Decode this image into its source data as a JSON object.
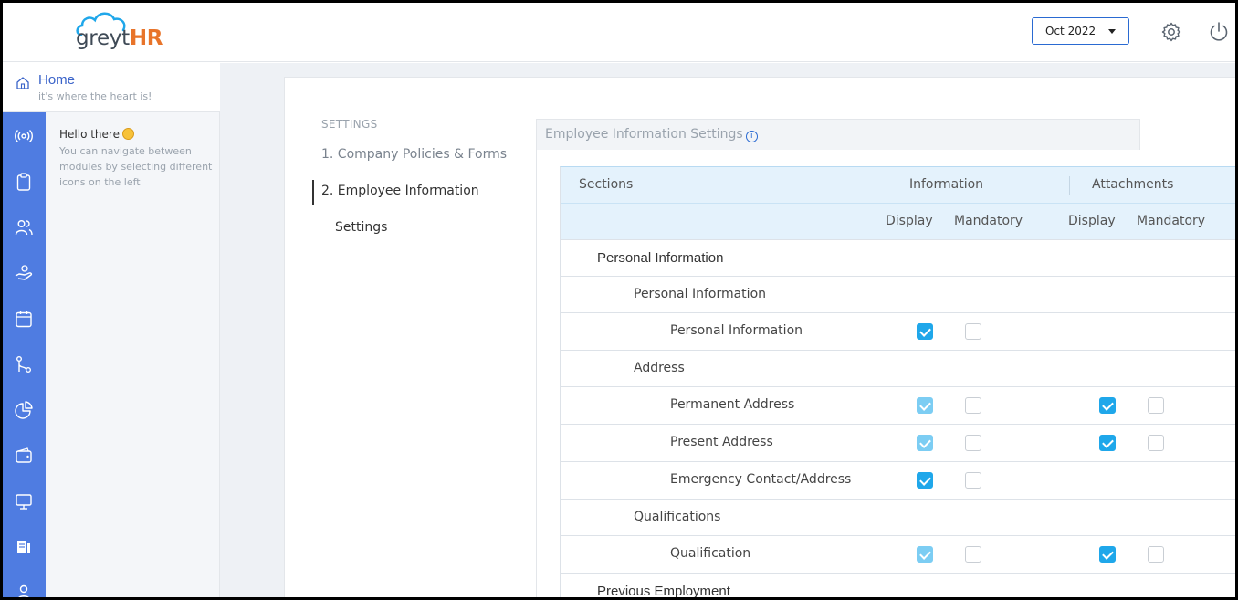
{
  "brand": {
    "logo_text_1": "greyt",
    "logo_text_2": "HR"
  },
  "header": {
    "month_value": "Oct 2022"
  },
  "home": {
    "title": "Home",
    "subtitle": "it's where the heart is!"
  },
  "help": {
    "greeting": "Hello there",
    "message": "You can navigate between modules by selecting different icons on the left"
  },
  "rail_icons": [
    "broadcast-icon",
    "clipboard-icon",
    "users-icon",
    "hand-coins-icon",
    "calendar-icon",
    "workflow-icon",
    "pie-chart-icon",
    "wallet-icon",
    "monitor-icon",
    "document-icon",
    "person-icon"
  ],
  "settings_nav": {
    "heading": "SETTINGS",
    "items": [
      {
        "label": "1. Company Policies & Forms",
        "active": false
      },
      {
        "label": "2. Employee Information",
        "active": true
      },
      {
        "label": "Settings",
        "active": true
      }
    ]
  },
  "content": {
    "title": "Employee Information Settings",
    "columns": {
      "sections": "Sections",
      "information": "Information",
      "attachments": "Attachments",
      "display": "Display",
      "mandatory": "Mandatory"
    },
    "rows": [
      {
        "label": "Personal Information",
        "level": 0
      },
      {
        "label": "Personal Information",
        "level": 1
      },
      {
        "label": "Personal Information",
        "level": 2,
        "info_display": "checked",
        "info_mandatory": "unchecked"
      },
      {
        "label": "Address",
        "level": 1
      },
      {
        "label": "Permanent Address",
        "level": 2,
        "info_display": "checked-disabled",
        "info_mandatory": "unchecked",
        "att_display": "checked",
        "att_mandatory": "unchecked"
      },
      {
        "label": "Present Address",
        "level": 2,
        "info_display": "checked-disabled",
        "info_mandatory": "unchecked",
        "att_display": "checked",
        "att_mandatory": "unchecked"
      },
      {
        "label": "Emergency Contact/Address",
        "level": 2,
        "info_display": "checked",
        "info_mandatory": "unchecked"
      },
      {
        "label": "Qualifications",
        "level": 1
      },
      {
        "label": "Qualification",
        "level": 2,
        "info_display": "checked-disabled",
        "info_mandatory": "unchecked",
        "att_display": "checked",
        "att_mandatory": "unchecked"
      },
      {
        "label": "Previous Employment",
        "level": 0
      }
    ]
  },
  "colors": {
    "accent": "#4f7ce1",
    "checkbox": "#1fa7ea",
    "logo_orange": "#e8742a"
  }
}
